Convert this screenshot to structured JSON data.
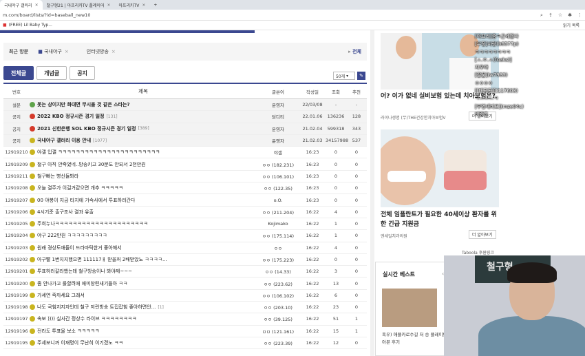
{
  "browser": {
    "tabs": [
      {
        "label": "국내야구 갤러리",
        "active": true
      },
      {
        "label": "철구형21 | 아프리카TV 플레이어",
        "active": false
      },
      {
        "label": "아프리카TV",
        "active": false
      }
    ],
    "url": "m.com/board/lists/?id=baseball_new10",
    "bookmark": "(FREE) Lil Baby Typ...",
    "bookmark_right": "읽기 목록"
  },
  "recent": {
    "label": "최근 방문",
    "items": [
      "국내야구",
      "인터넷방송"
    ],
    "all": "전체"
  },
  "board_tabs": [
    "전체글",
    "개념글",
    "공지"
  ],
  "per_page": "50개",
  "table": {
    "headers": {
      "no": "번호",
      "title": "제목",
      "writer": "글쓴이",
      "date": "작성일",
      "views": "조회",
      "rec": "추천"
    },
    "rows": [
      {
        "no": "설문",
        "title": "못는 상이지만 화대면 무시을 것 같은 스타는?",
        "cnt": "",
        "writer": "운영자",
        "date": "22/03/08",
        "views": "-",
        "rec": "-",
        "type": "notice",
        "icon": "g"
      },
      {
        "no": "공지",
        "title": "2022 KBO 정규시즌 경기 일정",
        "cnt": "[131]",
        "writer": "딛디티",
        "date": "22.01.06",
        "views": "136236",
        "rec": "128",
        "type": "notice",
        "icon": "r"
      },
      {
        "no": "공지",
        "title": "2021 신한은행 SOL KBO 정규시즌 경기 일정",
        "cnt": "[389]",
        "writer": "운영자",
        "date": "21.02.04",
        "views": "599318",
        "rec": "343",
        "type": "notice",
        "icon": "r"
      },
      {
        "no": "공지",
        "title": "국내야구 갤러리 이용 안내",
        "cnt": "[1077]",
        "writer": "운영자",
        "date": "21.02.03",
        "views": "34157988",
        "rec": "537",
        "type": "notice",
        "icon": "y"
      },
      {
        "no": "12919210",
        "title": "야갤 입갤 ㅋㅋㅋㅋㅋㅋㅋㅋㅋㅋㅋㅋㅋㅋㅋㅋㅋㅋㅋㅋㅋㅋㅋ",
        "cnt": "",
        "writer": "야갤",
        "date": "16:23",
        "views": "0",
        "rec": "0",
        "type": "post",
        "icon": "y"
      },
      {
        "no": "12919209",
        "title": "철구 아직 안죽었네..방송키고 30분도 안되서 2천만원",
        "cnt": "",
        "writer": "ㅇㅇ (182.231)",
        "date": "16:23",
        "views": "0",
        "rec": "0",
        "type": "post",
        "icon": "y"
      },
      {
        "no": "12919211",
        "title": "철구빠는 병신들봐라",
        "cnt": "",
        "writer": "ㅇㅇ (106.101)",
        "date": "16:23",
        "views": "0",
        "rec": "0",
        "type": "post",
        "icon": "y"
      },
      {
        "no": "12919208",
        "title": "오늘 결주가 이길거같으면 개추 ㅋㅋㅋㅋㅋ",
        "cnt": "",
        "writer": "ㅇㅇ (122.35)",
        "date": "16:23",
        "views": "0",
        "rec": "0",
        "type": "post",
        "icon": "y"
      },
      {
        "no": "12919207",
        "title": "00 야붕이 지금 타지에 가속사에서 투표하러간다",
        "cnt": "",
        "writer": "o.O.",
        "date": "16:23",
        "views": "0",
        "rec": "0",
        "type": "post",
        "icon": "y"
      },
      {
        "no": "12919206",
        "title": "4시기준 출구조사 결과 유출",
        "cnt": "",
        "writer": "ㅇㅇ (211.204)",
        "date": "16:22",
        "views": "4",
        "rec": "0",
        "type": "post",
        "icon": "y"
      },
      {
        "no": "12919205",
        "title": "주희누나ㅋㅋㅋㅋㅋㅋㅋㅋㅋㅋㅋㅋㅋㅋㅋㅋㅋㅋㅋㅋㅋ",
        "cnt": "",
        "writer": "Kojimako",
        "date": "16:22",
        "views": "1",
        "rec": "0",
        "type": "post",
        "icon": "y"
      },
      {
        "no": "12919204",
        "title": "야구 222만원 ㅋㅋㅋㅋㅋㅋㅋㅋㅋ",
        "cnt": "",
        "writer": "ㅇㅇ (175.114)",
        "date": "16:22",
        "views": "1",
        "rec": "0",
        "type": "post",
        "icon": "y"
      },
      {
        "no": "12919203",
        "title": "원래 경상도애들이 드라마틱한거 좋아해서",
        "cnt": "",
        "writer": "ㅇㅇ",
        "date": "16:22",
        "views": "4",
        "rec": "0",
        "type": "post",
        "icon": "y"
      },
      {
        "no": "12919202",
        "title": "아구빨 1번지지했으면 111117ㅐ 받을꺼 2배받았노 ㅋㅋㅋㅋ...",
        "cnt": "",
        "writer": "ㅇㅇ (175.223)",
        "date": "16:22",
        "views": "0",
        "rec": "0",
        "type": "post",
        "icon": "y"
      },
      {
        "no": "12919201",
        "title": "투표하러갈라했는데 철구방송이나 봐야제~~~",
        "cnt": "",
        "writer": "ㅇㅇ (14.33)",
        "date": "16:22",
        "views": "3",
        "rec": "0",
        "type": "post",
        "icon": "y"
      },
      {
        "no": "12919200",
        "title": "좀 안나가고 룰할려애 애미창련새기들아 ㅋㅋ",
        "cnt": "",
        "writer": "ㅇㅇ (223.62)",
        "date": "16:22",
        "views": "13",
        "rec": "0",
        "type": "post",
        "icon": "y"
      },
      {
        "no": "12919199",
        "title": "가세연 족까세요 그래서",
        "cnt": "",
        "writer": "ㅇㅇ (106.102)",
        "date": "16:22",
        "views": "6",
        "rec": "0",
        "type": "post",
        "icon": "y"
      },
      {
        "no": "12919198",
        "title": "나도 국힘지지자인데 철구 저런방송 트집잡힘 좋아하면안...",
        "cnt": "[1]",
        "writer": "ㅇㅇ (203.10)",
        "date": "16:22",
        "views": "23",
        "rec": "0",
        "type": "post",
        "icon": "y"
      },
      {
        "no": "12919197",
        "title": "속보 )))) 실사간 정상수 라이브 ㅋㅋㅋㅋㅋㅋㅋㅋ",
        "cnt": "",
        "writer": "ㅇㅇ (39.125)",
        "date": "16:22",
        "views": "51",
        "rec": "1",
        "type": "post",
        "icon": "y"
      },
      {
        "no": "12919196",
        "title": "전라도 투표율 보소 ㅋㅋㅋㅋㅋ",
        "cnt": "",
        "writer": "ㅁㅁ (121.161)",
        "date": "16:22",
        "views": "15",
        "rec": "1",
        "type": "post",
        "icon": "y"
      },
      {
        "no": "12919195",
        "title": "주세보니까 이재명이 무난히 이기겠노 ㅋㅋ",
        "cnt": "",
        "writer": "ㅇㅇ (223.39)",
        "date": "16:22",
        "views": "12",
        "rec": "0",
        "type": "post",
        "icon": "y"
      }
    ]
  },
  "ads": {
    "ad1_title": "어? 이가 없네 실비보험 있는데 치아보험은?",
    "ad1_src": "라이나생명 (무)THE건강한치아보험V",
    "ad_more": "더 알아보기",
    "ad2_title": "전체 임플란트가 필요한 40세이상 환자를 위한 긴급 지원금",
    "ad2_src": "엔세일치과의원",
    "taboola": "Taboola 후원링크"
  },
  "best": {
    "title": "실시간 베스트",
    "nav": "‹ ›",
    "caption": "흑우) 애플카로수길 저 승 플레이반아본 후기"
  },
  "chat": [
    "[아프리]중ㅋ근세월다",
    "[우정]사랑(b6577p)",
    "ㅋㅋㅋㅋㅋㅋㅋㅋ",
    "[ㅅ.ㅇ.ㅅ(foaks)]",
    "지우야",
    "[팔꿈](w7933)",
    "ㅇㅇㅇㅇ",
    "[[대곡동]](117603)",
    "ㅋ———ㅋ",
    "[부엉새비프](mze04c)",
    "비랑츠"
  ],
  "webcam": {
    "bg_text": "철구형"
  }
}
